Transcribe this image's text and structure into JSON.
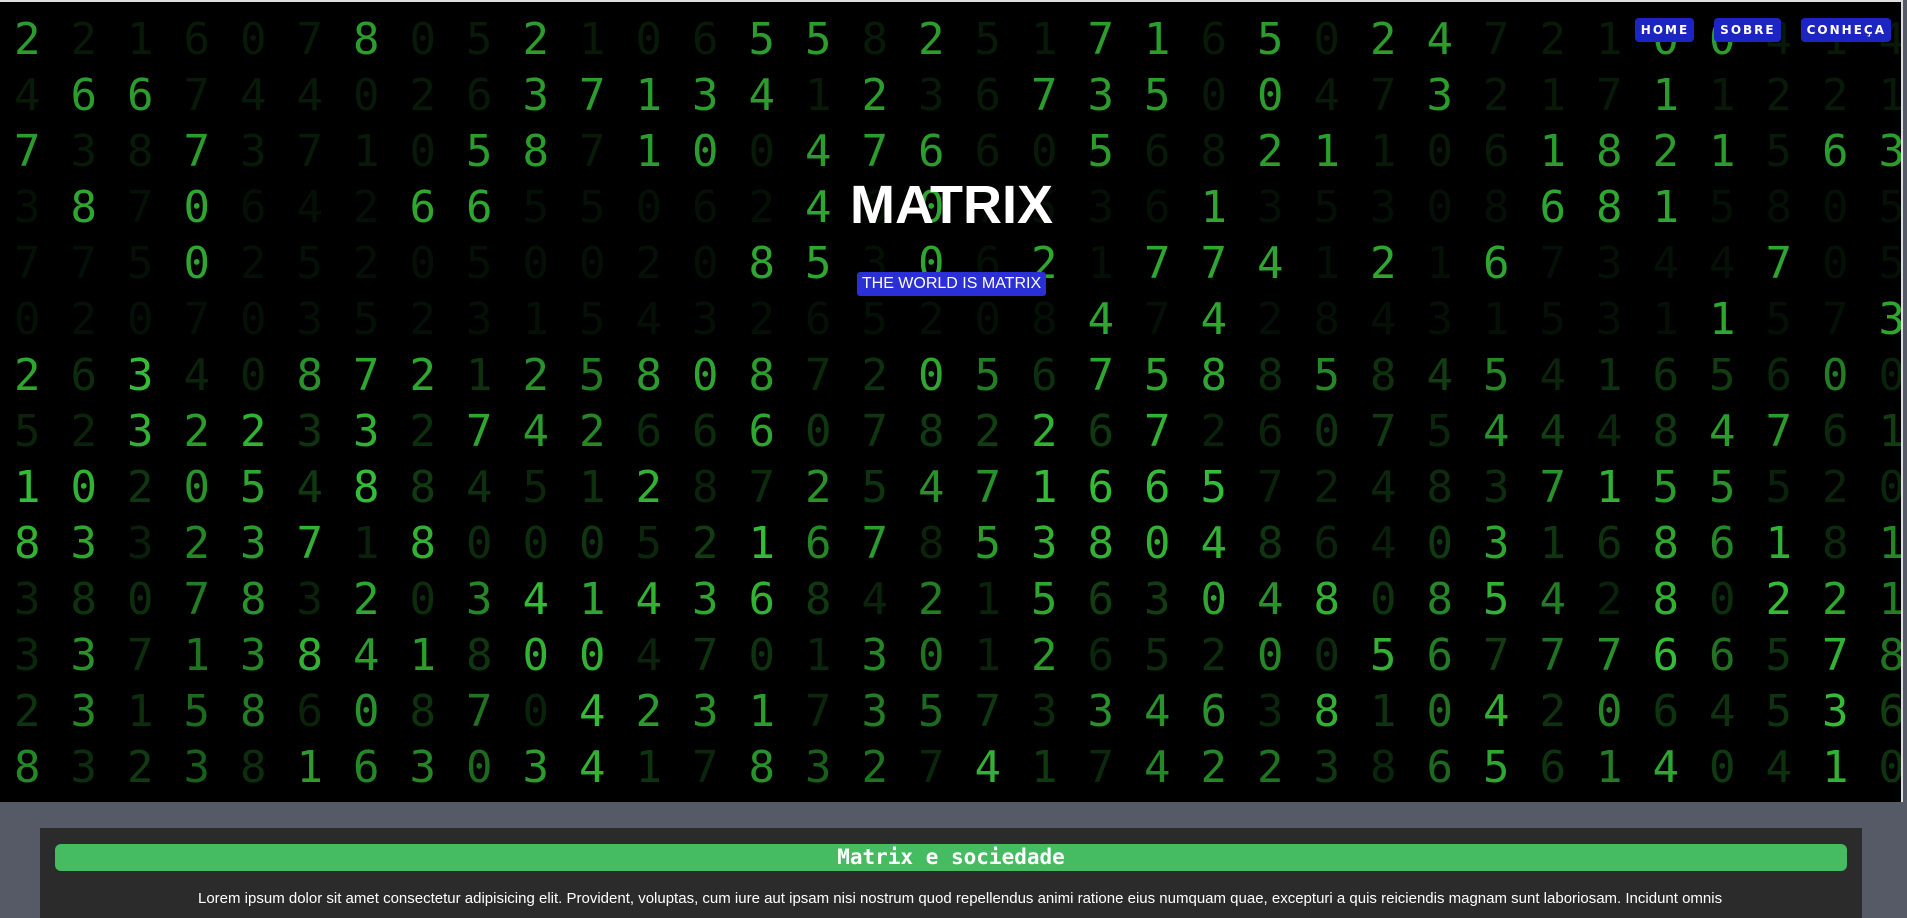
{
  "nav": {
    "home": "HOME",
    "about": "SOBRE",
    "discover": "CONHEÇA"
  },
  "hero": {
    "title": "MATRIX",
    "subtitle": "THE WORLD IS MATRIX",
    "background": "matrix-digital-rain"
  },
  "section": {
    "title": "Matrix e sociedade",
    "paragraph": "Lorem ipsum dolor sit amet consectetur adipisicing elit. Provident, voluptas, cum iure aut ipsam nisi nostrum quod repellendus animi ratione eius numquam quae, excepturi a quis reiciendis magnam sunt laboriosam. Incidunt omnis"
  },
  "colors": {
    "nav_button": "#1c24c4",
    "subtitle_bg": "#2a2fd6",
    "rain_green": "#39d13c",
    "section_bar": "#45bb62",
    "content_bg": "#2b2b2b",
    "page_bg": "#565a66"
  }
}
